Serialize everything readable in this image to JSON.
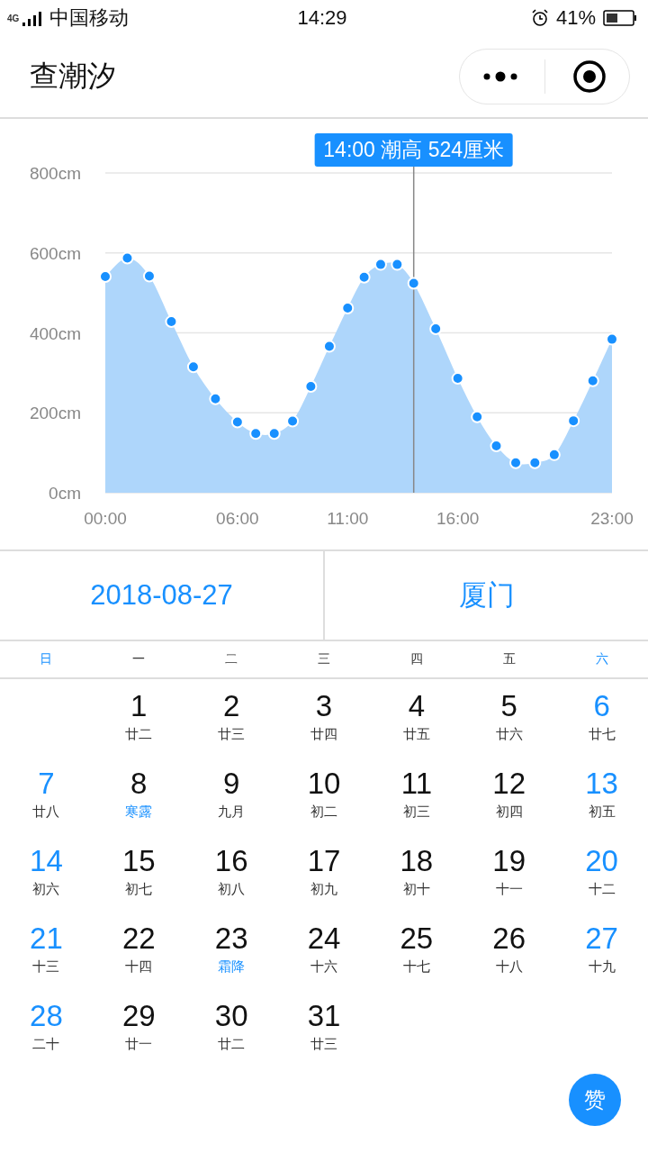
{
  "status_bar": {
    "network": "4G",
    "carrier": "中国移动",
    "time": "14:29",
    "battery": "41%"
  },
  "nav": {
    "title": "查潮汐"
  },
  "tide": {
    "chart_data": {
      "type": "area",
      "x": [
        0,
        1,
        2,
        3,
        4,
        5,
        6,
        6.83,
        7.67,
        8.5,
        9.33,
        10.17,
        11,
        11.75,
        12.5,
        13.25,
        14,
        15,
        16,
        16.88,
        17.75,
        18.63,
        19.5,
        20.38,
        21.25,
        22.13,
        23
      ],
      "xlim": [
        0,
        23
      ],
      "grid": true,
      "series": [
        {
          "color": "#aed6fb",
          "values": [
            541,
            587,
            542,
            428,
            315,
            235,
            177,
            148,
            148,
            179,
            266,
            366,
            462,
            539,
            571,
            571,
            524,
            410,
            286,
            190,
            117,
            75,
            75,
            95,
            180,
            280,
            384
          ]
        }
      ],
      "ylim": [
        0,
        800
      ],
      "yticks": [
        {
          "value": 0,
          "label": "0cm"
        },
        {
          "value": 200,
          "label": "200cm"
        },
        {
          "value": 400,
          "label": "400cm"
        },
        {
          "value": 600,
          "label": "600cm"
        },
        {
          "value": 800,
          "label": "800cm"
        }
      ],
      "xticks": [
        {
          "value": 0,
          "label": "00:00"
        },
        {
          "value": 6,
          "label": "06:00"
        },
        {
          "value": 11,
          "label": "11:00"
        },
        {
          "value": 16,
          "label": "16:00"
        },
        {
          "value": 23,
          "label": "23:00"
        }
      ],
      "ref_lines": [
        {
          "axis": "x",
          "value": 14
        }
      ],
      "annotations": [
        "14:00 潮高 524厘米"
      ]
    }
  },
  "selector": {
    "date": "2018-08-27",
    "location": "厦门"
  },
  "calendar": {
    "weekdays": [
      "日",
      "一",
      "二",
      "三",
      "四",
      "五",
      "六"
    ],
    "weeks": [
      [
        {
          "day": "1",
          "lunar": "廿二",
          "term": false
        },
        {
          "day": "2",
          "lunar": "廿三",
          "term": false
        },
        {
          "day": "3",
          "lunar": "廿四",
          "term": false
        },
        {
          "day": "4",
          "lunar": "廿五",
          "term": false
        },
        {
          "day": "5",
          "lunar": "廿六",
          "term": false
        },
        {
          "day": "6",
          "lunar": "廿七",
          "term": false
        }
      ],
      [
        {
          "day": "7",
          "lunar": "廿八",
          "term": false
        },
        {
          "day": "8",
          "lunar": "寒露",
          "term": true
        },
        {
          "day": "9",
          "lunar": "九月",
          "term": false
        },
        {
          "day": "10",
          "lunar": "初二",
          "term": false
        },
        {
          "day": "11",
          "lunar": "初三",
          "term": false
        },
        {
          "day": "12",
          "lunar": "初四",
          "term": false
        },
        {
          "day": "13",
          "lunar": "初五",
          "term": false
        }
      ],
      [
        {
          "day": "14",
          "lunar": "初六",
          "term": false
        },
        {
          "day": "15",
          "lunar": "初七",
          "term": false
        },
        {
          "day": "16",
          "lunar": "初八",
          "term": false
        },
        {
          "day": "17",
          "lunar": "初九",
          "term": false
        },
        {
          "day": "18",
          "lunar": "初十",
          "term": false
        },
        {
          "day": "19",
          "lunar": "十一",
          "term": false
        },
        {
          "day": "20",
          "lunar": "十二",
          "term": false
        }
      ],
      [
        {
          "day": "21",
          "lunar": "十三",
          "term": false
        },
        {
          "day": "22",
          "lunar": "十四",
          "term": false
        },
        {
          "day": "23",
          "lunar": "霜降",
          "term": true
        },
        {
          "day": "24",
          "lunar": "十六",
          "term": false
        },
        {
          "day": "25",
          "lunar": "十七",
          "term": false
        },
        {
          "day": "26",
          "lunar": "十八",
          "term": false
        },
        {
          "day": "27",
          "lunar": "十九",
          "term": false
        }
      ],
      [
        {
          "day": "28",
          "lunar": "二十",
          "term": false
        },
        {
          "day": "29",
          "lunar": "廿一",
          "term": false
        },
        {
          "day": "30",
          "lunar": "廿二",
          "term": false
        },
        {
          "day": "31",
          "lunar": "廿三",
          "term": false
        }
      ]
    ]
  },
  "like_button": {
    "label": "赞"
  }
}
